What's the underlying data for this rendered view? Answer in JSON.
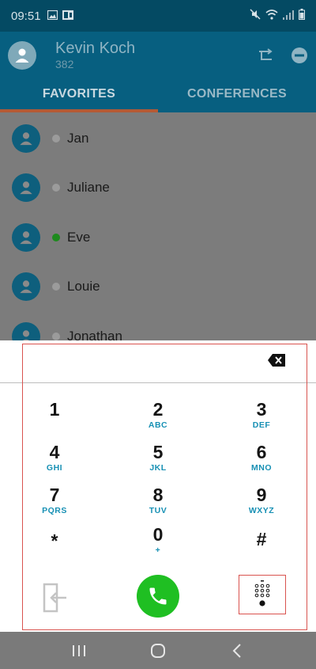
{
  "status_bar": {
    "time": "09:51",
    "left_icons": [
      "gallery-icon",
      "outlook-icon"
    ],
    "right_icons": [
      "mute-icon",
      "wifi-icon",
      "signal-icon",
      "battery-icon"
    ]
  },
  "header": {
    "user_name": "Kevin Koch",
    "extension": "382",
    "actions": [
      "call-forward-icon",
      "do-not-disturb-icon"
    ]
  },
  "tabs": [
    {
      "label": "FAVORITES",
      "active": true
    },
    {
      "label": "CONFERENCES",
      "active": false
    }
  ],
  "contacts": [
    {
      "name": "Jan",
      "status": "offline"
    },
    {
      "name": "Juliane",
      "status": "offline"
    },
    {
      "name": "Eve",
      "status": "online"
    },
    {
      "name": "Louie",
      "status": "offline"
    },
    {
      "name": "Jonathan",
      "status": "offline"
    }
  ],
  "dialpad": {
    "number": "",
    "keys": [
      {
        "digit": "1",
        "letters": ""
      },
      {
        "digit": "2",
        "letters": "ABC"
      },
      {
        "digit": "3",
        "letters": "DEF"
      },
      {
        "digit": "4",
        "letters": "GHI"
      },
      {
        "digit": "5",
        "letters": "JKL"
      },
      {
        "digit": "6",
        "letters": "MNO"
      },
      {
        "digit": "7",
        "letters": "PQRS"
      },
      {
        "digit": "8",
        "letters": "TUV"
      },
      {
        "digit": "9",
        "letters": "WXYZ"
      },
      {
        "digit": "*",
        "letters": ""
      },
      {
        "digit": "0",
        "letters": "+"
      },
      {
        "digit": "#",
        "letters": ""
      }
    ]
  },
  "colors": {
    "header": "#075f80",
    "accent_tab": "#b45a35",
    "letters": "#1790b4",
    "call": "#1fbf22",
    "highlight": "#d9534f",
    "online": "#1d8a1d"
  }
}
